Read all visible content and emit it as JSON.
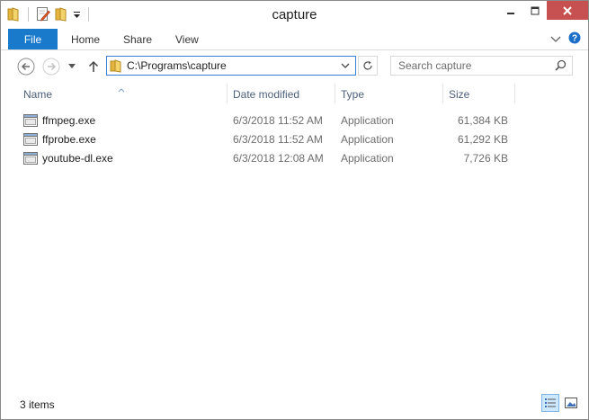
{
  "window": {
    "title": "capture"
  },
  "ribbon": {
    "tabs": [
      {
        "label": "File"
      },
      {
        "label": "Home"
      },
      {
        "label": "Share"
      },
      {
        "label": "View"
      }
    ]
  },
  "address": {
    "path": "C:\\Programs\\capture"
  },
  "search": {
    "placeholder": "Search capture"
  },
  "columns": [
    "Name",
    "Date modified",
    "Type",
    "Size"
  ],
  "files": [
    {
      "name": "ffmpeg.exe",
      "date": "6/3/2018 11:52 AM",
      "type": "Application",
      "size": "61,384 KB"
    },
    {
      "name": "ffprobe.exe",
      "date": "6/3/2018 11:52 AM",
      "type": "Application",
      "size": "61,292 KB"
    },
    {
      "name": "youtube-dl.exe",
      "date": "6/3/2018 12:08 AM",
      "type": "Application",
      "size": "7,726 KB"
    }
  ],
  "status": {
    "item_count": "3 items"
  },
  "colors": {
    "accent": "#1979ca",
    "close": "#c75050",
    "header_text": "#4c607a",
    "folder": "#e8c04a"
  }
}
